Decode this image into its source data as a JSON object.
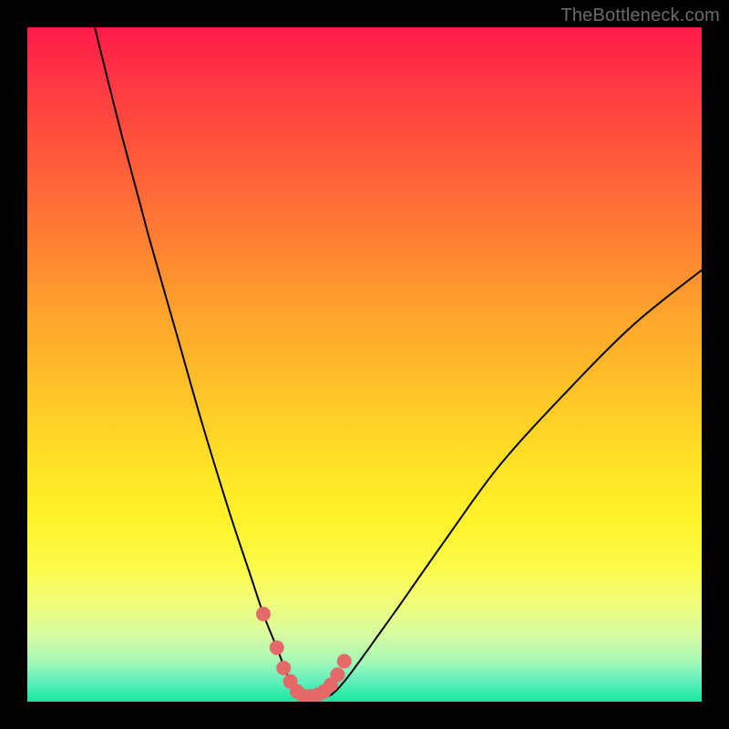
{
  "watermark": "TheBottleneck.com",
  "colors": {
    "background_frame": "#000000",
    "curve_stroke": "#000000",
    "dot_fill": "#e46a6a",
    "gradient_top": "#ff1a4a",
    "gradient_bottom": "#15e8a0"
  },
  "chart_data": {
    "type": "line",
    "title": "",
    "xlabel": "",
    "ylabel": "",
    "xlim": [
      0,
      100
    ],
    "ylim": [
      0,
      100
    ],
    "grid": false,
    "note": "Asymmetric V-shaped bottleneck curve. Minimum near x≈41, y≈0. Left branch reaches y=100 at x≈10; right branch reaches y≈64 at x=100. Dots cluster at the valley floor.",
    "series": [
      {
        "name": "bottleneck-curve",
        "x": [
          10,
          14,
          18,
          22,
          26,
          30,
          33,
          35,
          37,
          39,
          41,
          43,
          45,
          47,
          50,
          55,
          62,
          70,
          80,
          90,
          100
        ],
        "y": [
          100,
          84,
          69,
          55,
          41,
          28,
          19,
          13,
          8,
          3,
          0.5,
          0.5,
          1,
          3,
          7,
          14,
          24,
          35,
          46,
          56,
          64
        ]
      },
      {
        "name": "highlight-dots",
        "x": [
          35,
          37,
          38,
          39,
          40,
          41,
          42,
          43,
          44,
          45,
          46,
          47
        ],
        "y": [
          13,
          8,
          5,
          3,
          1.5,
          0.8,
          0.8,
          1,
          1.5,
          2.5,
          4,
          6
        ]
      }
    ]
  }
}
